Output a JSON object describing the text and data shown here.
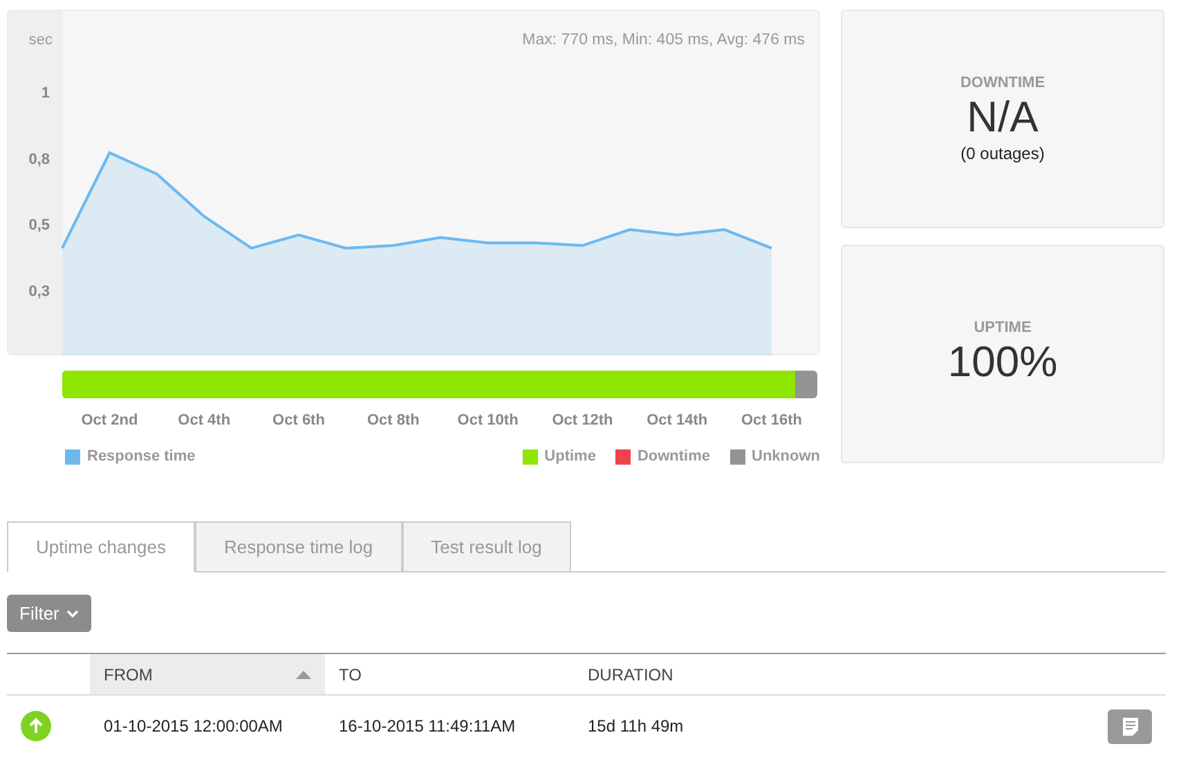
{
  "chart": {
    "summary": "Max: 770 ms, Min: 405 ms, Avg: 476 ms",
    "chart_data": {
      "type": "area",
      "ylabel": "sec",
      "categories": [
        null,
        "Oct 2nd",
        null,
        "Oct 4th",
        null,
        "Oct 6th",
        null,
        "Oct 8th",
        null,
        "Oct 10th",
        null,
        "Oct 12th",
        null,
        "Oct 14th",
        null,
        "Oct 16th"
      ],
      "ylim": [
        0,
        1.31
      ],
      "yticks": [
        {
          "value": 1,
          "label": "1"
        },
        {
          "value": 0.75,
          "label": "0,8"
        },
        {
          "value": 0.5,
          "label": "0,5"
        },
        {
          "value": 0.25,
          "label": "0,3"
        }
      ],
      "series": [
        {
          "name": "Response time",
          "color": "#6cb9f0",
          "values": [
            0.41,
            0.77,
            0.69,
            0.53,
            0.41,
            0.46,
            0.41,
            0.42,
            0.45,
            0.43,
            0.43,
            0.42,
            0.48,
            0.46,
            0.48,
            0.41
          ]
        }
      ]
    }
  },
  "availability_bar": {
    "level": 0.97
  },
  "legend": [
    {
      "label": "Uptime",
      "color": "#8ee500"
    },
    {
      "label": "Downtime",
      "color": "#f0424b"
    },
    {
      "label": "Unknown",
      "color": "#949494"
    }
  ],
  "cards": [
    {
      "title": "DOWNTIME",
      "value": "N/A",
      "note": "(0 outages)"
    },
    {
      "title": "UPTIME",
      "value": "100%"
    }
  ],
  "tabs": [
    {
      "label": "Uptime changes",
      "selected": true
    },
    {
      "label": "Response time log",
      "selected": false
    },
    {
      "label": "Test result log",
      "selected": false
    }
  ],
  "filter": {
    "label": "Filter"
  },
  "table": {
    "columns": [
      {
        "label": "FROM",
        "sorted": true
      },
      {
        "label": "TO",
        "sorted": false
      },
      {
        "label": "DURATION",
        "sorted": false
      }
    ],
    "rows": [
      {
        "kind": "up",
        "from": "01-10-2015 12:00:00AM",
        "to": "16-10-2015 11:49:11AM",
        "duration": "15d 11h 49m"
      }
    ]
  }
}
